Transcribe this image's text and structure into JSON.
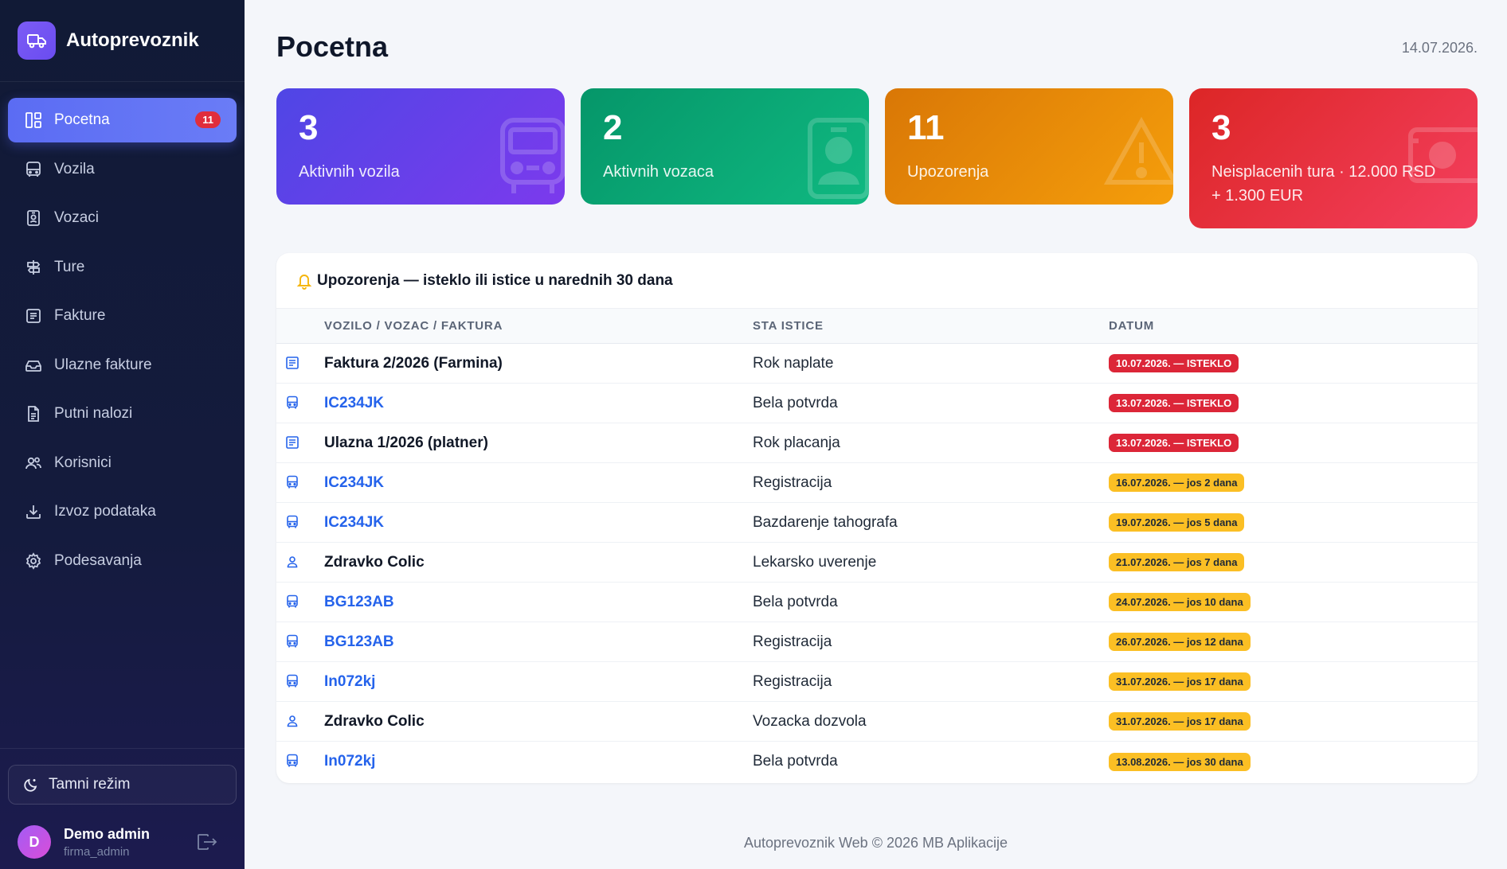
{
  "brand": {
    "title": "Autoprevoznik"
  },
  "sidebar": {
    "items": [
      {
        "label": "Pocetna",
        "icon": "dashboard-icon",
        "active": true,
        "badge": "11"
      },
      {
        "label": "Vozila",
        "icon": "bus-icon"
      },
      {
        "label": "Vozaci",
        "icon": "id-card-icon"
      },
      {
        "label": "Ture",
        "icon": "signpost-icon"
      },
      {
        "label": "Fakture",
        "icon": "invoice-icon"
      },
      {
        "label": "Ulazne fakture",
        "icon": "inbox-icon"
      },
      {
        "label": "Putni nalozi",
        "icon": "document-icon"
      },
      {
        "label": "Korisnici",
        "icon": "users-icon"
      },
      {
        "label": "Izvoz podataka",
        "icon": "download-icon"
      },
      {
        "label": "Podesavanja",
        "icon": "gear-icon"
      }
    ],
    "theme_label": "Tamni režim",
    "user": {
      "initial": "D",
      "name": "Demo admin",
      "role": "firma_admin"
    }
  },
  "header": {
    "title": "Pocetna",
    "date": "14.07.2026."
  },
  "cards": [
    {
      "value": "3",
      "label": "Aktivnih vozila",
      "icon": "bus-icon"
    },
    {
      "value": "2",
      "label": "Aktivnih vozaca",
      "icon": "id-card-icon"
    },
    {
      "value": "11",
      "label": "Upozorenja",
      "icon": "warning-icon"
    },
    {
      "value": "3",
      "label_line1": "Neisplacenih tura · 12.000 RSD",
      "label_line2": "+ 1.300 EUR",
      "icon": "money-icon"
    }
  ],
  "alerts": {
    "title": "Upozorenja — isteklo ili istice u narednih 30 dana",
    "columns": [
      "VOZILO / VOZAC / FAKTURA",
      "STA ISTICE",
      "DATUM"
    ],
    "rows": [
      {
        "type": "invoice",
        "name": "Faktura 2/2026 (Farmina)",
        "link": false,
        "what": "Rok naplate",
        "date": "10.07.2026. — ISTEKLO",
        "status": "red"
      },
      {
        "type": "vehicle",
        "name": "IC234JK",
        "link": true,
        "what": "Bela potvrda",
        "date": "13.07.2026. — ISTEKLO",
        "status": "red"
      },
      {
        "type": "invoice",
        "name": "Ulazna 1/2026 (platner)",
        "link": false,
        "what": "Rok placanja",
        "date": "13.07.2026. — ISTEKLO",
        "status": "red"
      },
      {
        "type": "vehicle",
        "name": "IC234JK",
        "link": true,
        "what": "Registracija",
        "date": "16.07.2026. — jos 2 dana",
        "status": "yellow"
      },
      {
        "type": "vehicle",
        "name": "IC234JK",
        "link": true,
        "what": "Bazdarenje tahografa",
        "date": "19.07.2026. — jos 5 dana",
        "status": "yellow"
      },
      {
        "type": "driver",
        "name": "Zdravko Colic",
        "link": false,
        "what": "Lekarsko uverenje",
        "date": "21.07.2026. — jos 7 dana",
        "status": "yellow"
      },
      {
        "type": "vehicle",
        "name": "BG123AB",
        "link": true,
        "what": "Bela potvrda",
        "date": "24.07.2026. — jos 10 dana",
        "status": "yellow"
      },
      {
        "type": "vehicle",
        "name": "BG123AB",
        "link": true,
        "what": "Registracija",
        "date": "26.07.2026. — jos 12 dana",
        "status": "yellow"
      },
      {
        "type": "vehicle",
        "name": "In072kj",
        "link": true,
        "what": "Registracija",
        "date": "31.07.2026. — jos 17 dana",
        "status": "yellow"
      },
      {
        "type": "driver",
        "name": "Zdravko Colic",
        "link": false,
        "what": "Vozacka dozvola",
        "date": "31.07.2026. — jos 17 dana",
        "status": "yellow"
      },
      {
        "type": "vehicle",
        "name": "In072kj",
        "link": true,
        "what": "Bela potvrda",
        "date": "13.08.2026. — jos 30 dana",
        "status": "yellow"
      }
    ]
  },
  "footer": {
    "text": "Autoprevoznik Web © 2026 MB Aplikacije"
  },
  "colors": {
    "accent": "#5b6cf3",
    "danger": "#dc2638",
    "warning": "#fbbf24",
    "link": "#2563eb"
  }
}
